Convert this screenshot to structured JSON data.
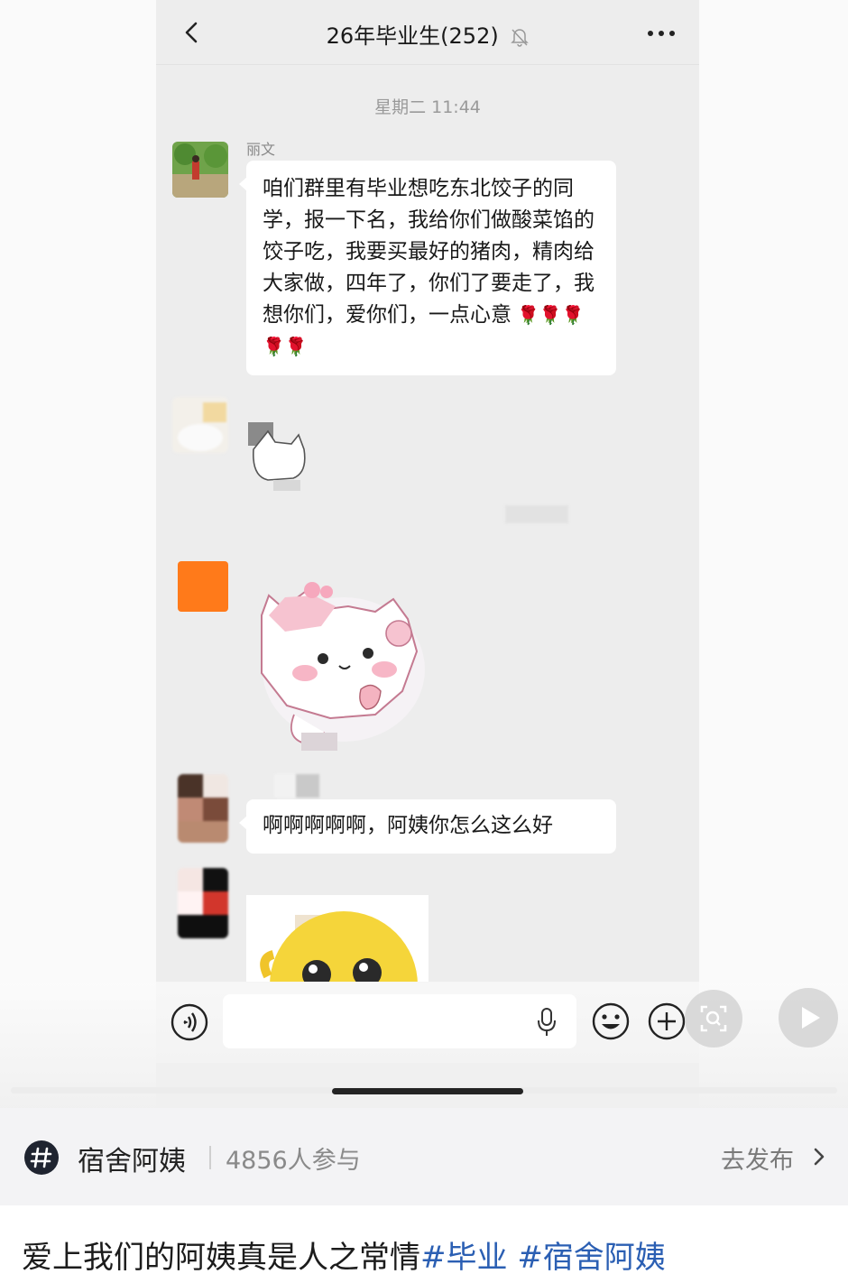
{
  "chat": {
    "title": "26年毕业生(252)",
    "timestamp": "星期二 11:44",
    "messages": [
      {
        "sender": "丽文",
        "text": "咱们群里有毕业想吃东北饺子的同学，报一下名，我给你们做酸菜馅的饺子吃，我要买最好的猪肉，精肉给大家做，四年了，你们了要走了，我想你们，爱你们，一点心意",
        "emoji": "🌹🌹🌹🌹🌹"
      },
      {
        "sender": "",
        "text": "啊啊啊啊啊，阿姨你怎么这么好"
      }
    ]
  },
  "icons": {
    "back": "chevron-left-icon",
    "mute": "bell-off-icon",
    "more": "more-dots-icon",
    "voice": "voice-icon",
    "mic": "mic-icon",
    "emoji": "emoji-icon",
    "add": "plus-circle-icon",
    "scan": "scan-icon",
    "play": "play-icon",
    "topic": "hashtag-icon"
  },
  "topic": {
    "name": "宿舍阿姨",
    "count": "4856人参与",
    "publish": "去发布"
  },
  "caption": {
    "text": "爱上我们的阿姨真是人之常情",
    "tag1": "#毕业",
    "tag2": "#宿舍阿姨"
  },
  "colors": {
    "chat_bg": "#ededed",
    "bubble": "#ffffff",
    "tag": "#2b5fb3"
  }
}
